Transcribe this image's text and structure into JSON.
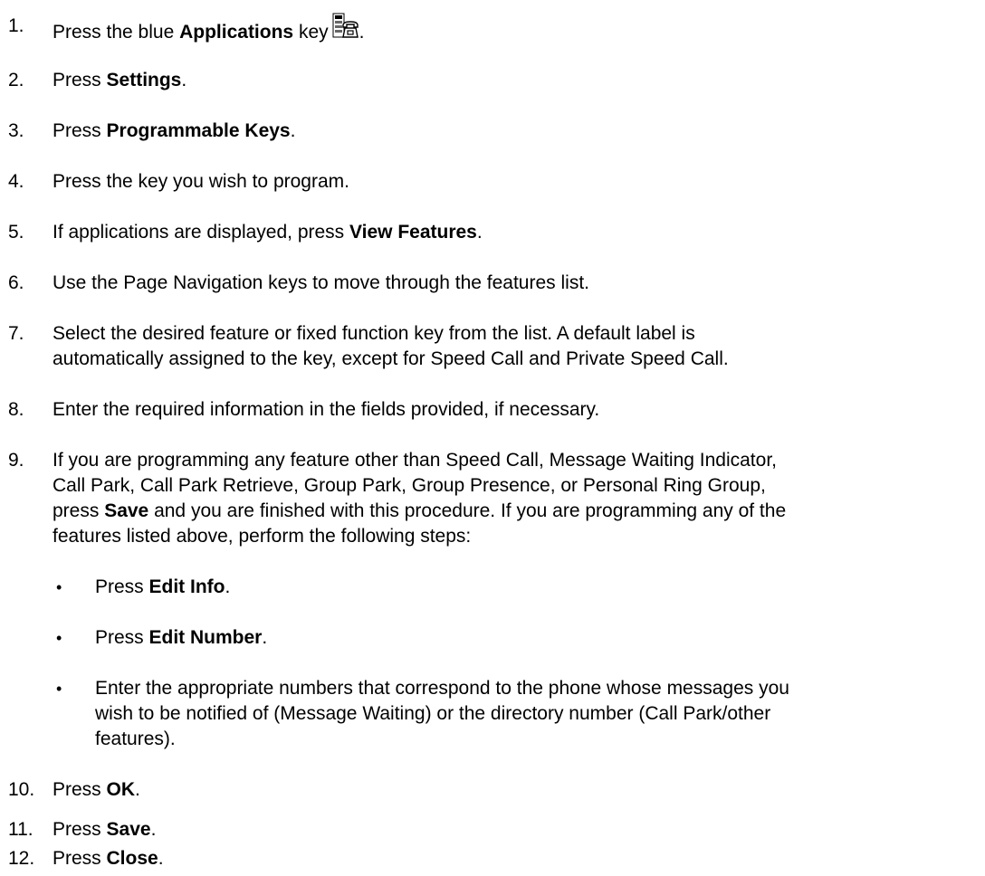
{
  "steps": [
    {
      "number": "1.",
      "before": "Press the blue ",
      "bold": "Applications",
      "after": " key",
      "icon": "applications-key-icon",
      "end": "."
    },
    {
      "number": "2.",
      "before": "Press ",
      "bold": "Settings",
      "after": "."
    },
    {
      "number": "3.",
      "before": "Press ",
      "bold": "Programmable Keys",
      "after": "."
    },
    {
      "number": "4.",
      "text": "Press the key you wish to program."
    },
    {
      "number": "5.",
      "before": "If applications are displayed, press ",
      "bold": "View Features",
      "after": "."
    },
    {
      "number": "6.",
      "text": "Use the Page Navigation keys to move through the features list."
    },
    {
      "number": "7.",
      "line1": "Select the desired feature or fixed function key from the list. A default label is",
      "line2": "automatically assigned to the key, except for Speed Call and Private Speed Call."
    },
    {
      "number": "8.",
      "text": "Enter the required information in the fields provided, if necessary."
    },
    {
      "number": "9.",
      "line1": "If you are programming any feature other than Speed Call, Message Waiting Indicator,",
      "line2": "Call Park, Call Park Retrieve, Group Park, Group Presence, or Personal Ring Group,",
      "line3_before": "press ",
      "line3_bold": "Save",
      "line3_after": " and you are finished with this procedure. If you are programming any of the",
      "line4": "features listed above, perform the following steps:"
    },
    {
      "number": "10.",
      "before": "Press ",
      "bold": "OK",
      "after": "."
    },
    {
      "number": "11.",
      "before": "Press ",
      "bold": "Save",
      "after": "."
    },
    {
      "number": "12.",
      "before": "Press ",
      "bold": "Close",
      "after": "."
    }
  ],
  "bullets": [
    {
      "symbol": "•",
      "before": "Press ",
      "bold": "Edit Info",
      "after": "."
    },
    {
      "symbol": "•",
      "before": "Press ",
      "bold": "Edit Number",
      "after": "."
    },
    {
      "symbol": "•",
      "line1": "Enter the appropriate numbers that correspond to the phone whose messages you",
      "line2": "wish to be notified of (Message Waiting) or the directory number (Call Park/other",
      "line3": "features)."
    }
  ]
}
